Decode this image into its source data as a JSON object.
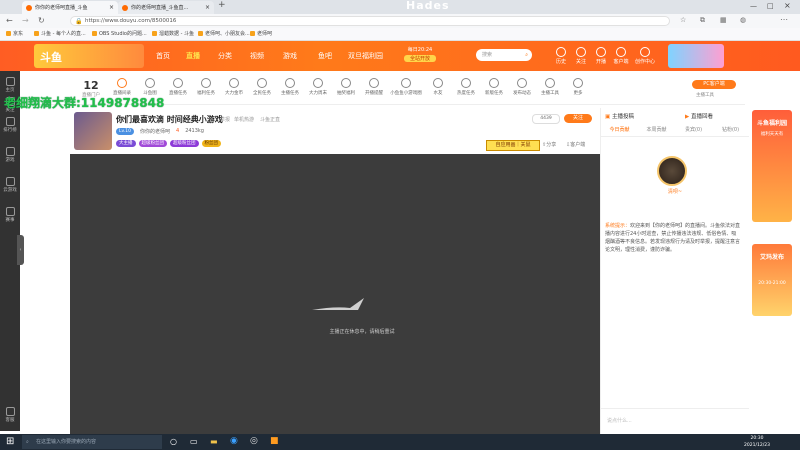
{
  "browser": {
    "tabs": [
      {
        "label": "你你的老师呵直播_斗鱼"
      },
      {
        "label": "你的老师呵直播_斗鱼直..."
      }
    ],
    "new_tab": "+",
    "url": "https://www.douyu.com/8500016",
    "bookmarks": [
      "京东",
      "斗鱼 - 每个人的直...",
      "OBS Studio的问题...",
      "溜蜡数据 - 斗鱼",
      "老师呵、小朋友会...",
      "老师呵"
    ]
  },
  "watermark_top": "Hades",
  "overlay_text": "老细翔滴大群:1149878848",
  "header": {
    "logo": "斗鱼",
    "nav": [
      "首页",
      "直播",
      "分类",
      "视频",
      "游戏",
      "鱼吧",
      "双旦福利园"
    ],
    "promo": {
      "line1": "每日20:24",
      "line2": "全站开放"
    },
    "search_placeholder": "搜索",
    "icons": [
      "历史",
      "关注",
      "开播",
      "客户端",
      "创作中心"
    ]
  },
  "sidebar": {
    "items": [
      "主页",
      "关注",
      "排行榜",
      "游戏",
      "云游戏",
      "赛事"
    ],
    "bottom": "客服"
  },
  "tools": {
    "day_number": "12",
    "day_label": "直播门户",
    "items": [
      "直播间录",
      "斗鱼图",
      "直播任务",
      "福利任务",
      "大力金币",
      "全民任务",
      "主播任务",
      "大力周末",
      "抽奖福利",
      "开播提醒",
      "小鱼鱼小游戏圈",
      "水友",
      "热度任务",
      "新版任务",
      "发布动态",
      "主播工具",
      "更多"
    ],
    "pc_button": "PC客户端",
    "pc_sub": "主播工具"
  },
  "room": {
    "title": "你们最喜欢滴 时间经典小游戏",
    "report": "举报",
    "category": "单机热游",
    "subcat": "斗鱼正直",
    "streamer": "你你的老师呵",
    "level": "Lv.10",
    "hot": "4",
    "followers": "2413kg",
    "follow_count": "4439",
    "follow_label": "关注",
    "share": "分享",
    "client": "客户端",
    "badges": [
      "大主播",
      "超级粉丝团",
      "超级粉丝团",
      "粉丝团"
    ],
    "gift_banner": "自应用画｜关鼠"
  },
  "player": {
    "loading_text": "主播正在休息中，请稍后重试"
  },
  "panel": {
    "tab_header": "主播投稿",
    "tab_right": "直播回看",
    "tabs": [
      "今日贡献",
      "本周贡献",
      "贵宾(0)",
      "钻粉(0)"
    ],
    "avatar_name": "清呗~",
    "notice_label": "系统提示：",
    "notice": "欢迎来到【你的老师呵】的直播间。斗鱼依法对直播内容进行24小时巡查，禁止传播违法违规、低俗色情、吸烟酗酒等不良信息。若发现违规行为请及时举报，提醒注意言论文明，理性消费，谨防诈骗。",
    "input_placeholder": "说点什么..."
  },
  "ads": [
    {
      "title": "斗鱼福利园",
      "sub": "福利天天有"
    },
    {
      "title": "艾玛发布",
      "sub": "20:30-21:00"
    }
  ],
  "taskbar": {
    "search_placeholder": "在这里输入你要搜索的内容",
    "time": "20:30",
    "date": "2021/12/23"
  }
}
